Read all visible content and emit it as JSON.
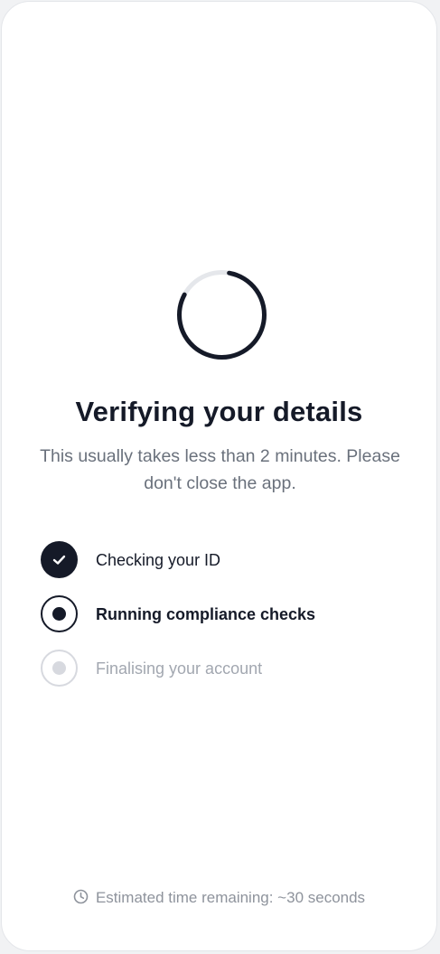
{
  "verification": {
    "title": "Verifying your details",
    "subtitle": "This usually takes less than 2 minutes. Please don't close the app.",
    "progress_fraction": 0.8,
    "steps": [
      {
        "label": "Checking your ID",
        "status": "done",
        "icon": "check-icon"
      },
      {
        "label": "Running compliance checks",
        "status": "active",
        "icon": "active-dot-icon"
      },
      {
        "label": "Finalising your account",
        "status": "pending",
        "icon": "pending-dot-icon"
      }
    ],
    "footer": {
      "icon": "clock-icon",
      "text": "Estimated time remaining: ~30 seconds"
    }
  },
  "colors": {
    "primary": "#151a28",
    "muted_text": "#6a717c",
    "pending": "#d7d9df",
    "spinner_track": "#e5e7eb"
  }
}
